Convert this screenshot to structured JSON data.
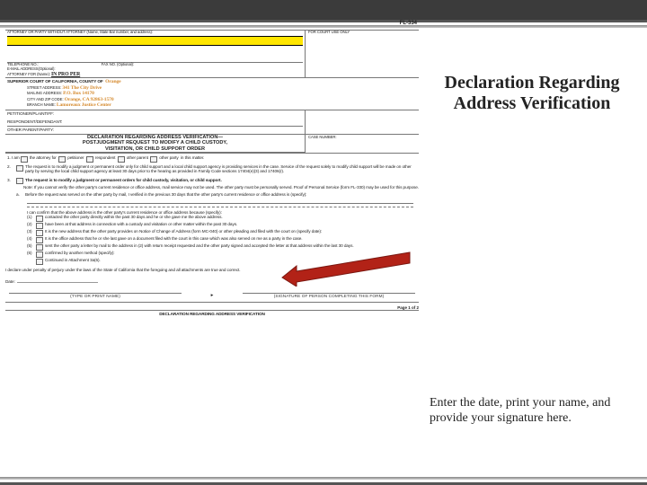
{
  "topbar": {},
  "right": {
    "heading_l1": "Declaration Regarding",
    "heading_l2": "Address Verification",
    "note": "Enter the date, print your name, and provide your signature here."
  },
  "form": {
    "form_number": "FL-334",
    "header": {
      "atty_line": "ATTORNEY OR PARTY WITHOUT ATTORNEY (Name, State Bar number, and address):",
      "court_use": "FOR COURT USE ONLY",
      "tel": "TELEPHONE NO.:",
      "fax": "FAX NO. (Optional):",
      "email": "E-MAIL ADDRESS(Optional):",
      "atty_for": "ATTORNEY FOR (Name):",
      "inpro": "IN PRO PER",
      "court_line": "SUPERIOR COURT OF CALIFORNIA, COUNTY OF",
      "county": "Orange",
      "street_lbl": "STREET ADDRESS:",
      "street": "341 The City Drive",
      "mail_lbl": "MAILING ADDRESS:",
      "mail": "P.O. Box 14170",
      "cityzip_lbl": "CITY AND ZIP CODE:",
      "cityzip": "Orange, CA 92863-1570",
      "branch_lbl": "BRANCH NAME:",
      "branch": "Lamoreaux Justice Center",
      "pet": "PETITIONER/PLAINTIFF:",
      "resp": "RESPONDENT/DEFENDANT:",
      "other": "OTHER PARENT/PARTY:",
      "case_lbl": "CASE NUMBER:",
      "title_l1": "DECLARATION REGARDING ADDRESS VERIFICATION—",
      "title_l2": "POSTJUDGMENT REQUEST TO MODIFY A CHILD CUSTODY,",
      "title_l3": "VISITATION, OR CHILD SUPPORT ORDER"
    },
    "item1": {
      "lead": "1.  I am",
      "opt_atty": "the attorney for",
      "opt_pet": "petitioner",
      "opt_resp": "respondent",
      "opt_oparent": "other parent",
      "opt_oparty": "other party",
      "tail": "in this matter."
    },
    "item2": {
      "lead": "2.",
      "text": "The request is to modify a judgment or permanent order only for child support and a local child support agency is providing services in the case. Service of the request solely to modify child support will be made on other party by serving the local child support agency at least 30 days prior to the hearing as provided in Family Code sections 17404(e)(3) and 17406(r)."
    },
    "item3": {
      "lead": "3.",
      "head": "The request is to modify a judgment or permanent orders for child custody, visitation, or child support.",
      "line2": "Note: If you cannot verify the other party's current residence or office address, mail service may not be used. The other party must be personally served. Proof of Personal Service (form FL-330) may be used for this purpose.",
      "a_lead": "a.",
      "a_text": "Before the request was served on the other party by mail, I verified in the previous 30 days that the other party's current residence or office address is (specify):",
      "confirm": "I can confirm that the above address is the other party's current residence or office address because (specify):",
      "c1": "contacted the other party directly within the past 30 days and he or she gave me the above address.",
      "c2": "have been at that address in connection with a custody and visitation or other matter within the past 30 days.",
      "c3": "It is the new address that the other party provides on Notice of Change of Address (form MC-040) or other pleading and filed with the court on (specify date):",
      "c4": "It is the office address that he or she last gave on a document filed with the court in this case which was also served on me as a party in the case.",
      "c5": "sent the other party a letter by mail to the address in (2) with return receipt requested and the other party signed and accepted the letter at that address within the last 30 days.",
      "c6": "confirmed by another method (specify):",
      "cont": "Continued in Attachment 3a(6).",
      "nums": {
        "n1": "(1)",
        "n2": "(2)",
        "n3": "(3)",
        "n4": "(4)",
        "n5": "(5)",
        "n6": "(6)"
      }
    },
    "perjury": "I declare under penalty of perjury under the laws of the State of California that the foregoing and all attachments are true and correct.",
    "date_lbl": "Date:",
    "type_print": "(TYPE OR PRINT NAME)",
    "sig_of": "(SIGNATURE OF PERSON COMPLETING THIS FORM)",
    "page": "Page 1 of 2",
    "decl_footer": "DECLARATION REGARDING ADDRESS VERIFICATION"
  }
}
